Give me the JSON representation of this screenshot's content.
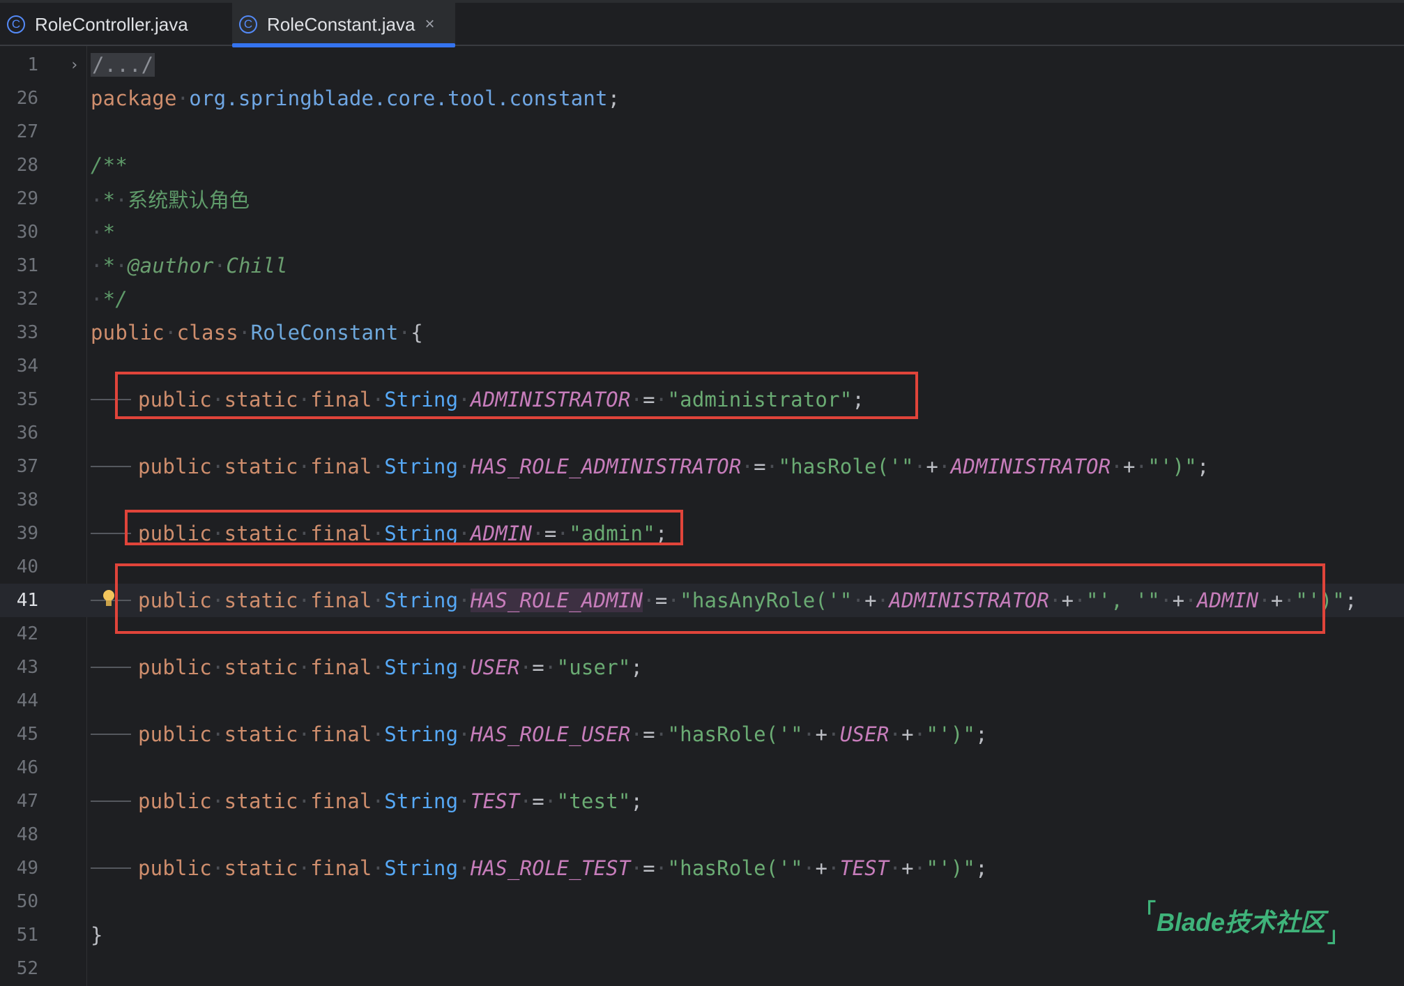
{
  "tabs": [
    {
      "label": "RoleController.java",
      "icon": "class-icon",
      "active": false
    },
    {
      "label": "RoleConstant.java",
      "icon": "class-icon",
      "active": true,
      "close": "×"
    }
  ],
  "editor": {
    "current_line": "41",
    "lines": [
      {
        "num": "1",
        "folded": "/.../"
      },
      {
        "num": "26",
        "kw": "package",
        "pkg": "org.springblade.core.tool.constant",
        "end": ";"
      },
      {
        "num": "27"
      },
      {
        "num": "28",
        "comment": "/**"
      },
      {
        "num": "29",
        "comment_star": "*",
        "comment_text": "系统默认角色"
      },
      {
        "num": "30",
        "comment_star": "*"
      },
      {
        "num": "31",
        "comment_star": "*",
        "tag": "@author",
        "tag_value": "Chill"
      },
      {
        "num": "32",
        "comment_end": "*/"
      },
      {
        "num": "33",
        "kw1": "public",
        "kw2": "class",
        "cls": "RoleConstant",
        "brace": "{"
      },
      {
        "num": "34"
      },
      {
        "num": "35",
        "mods": "public static final",
        "type": "String",
        "name": "ADMINISTRATOR",
        "eq": "=",
        "value": "\"administrator\"",
        "end": ";"
      },
      {
        "num": "36"
      },
      {
        "num": "37",
        "mods": "public static final",
        "type": "String",
        "name": "HAS_ROLE_ADMINISTRATOR",
        "eq": "=",
        "s1": "\"hasRole('\"",
        "op1": "+",
        "ref1": "ADMINISTRATOR",
        "op2": "+",
        "s2": "\"')\"",
        "end": ";"
      },
      {
        "num": "38"
      },
      {
        "num": "39",
        "mods": "public static final",
        "type": "String",
        "name": "ADMIN",
        "eq": "=",
        "value": "\"admin\"",
        "end": ";"
      },
      {
        "num": "40"
      },
      {
        "num": "41",
        "mods": "public static final",
        "type": "String",
        "name": "HAS_ROLE_ADMIN",
        "eq": "=",
        "s1": "\"hasAnyRole('\"",
        "op1": "+",
        "ref1": "ADMINISTRATOR",
        "op2": "+",
        "s2": "\"', '\"",
        "op3": "+",
        "ref2": "ADMIN",
        "op4": "+",
        "s3": "\"')\"",
        "end": ";"
      },
      {
        "num": "42"
      },
      {
        "num": "43",
        "mods": "public static final",
        "type": "String",
        "name": "USER",
        "eq": "=",
        "value": "\"user\"",
        "end": ";"
      },
      {
        "num": "44"
      },
      {
        "num": "45",
        "mods": "public static final",
        "type": "String",
        "name": "HAS_ROLE_USER",
        "eq": "=",
        "s1": "\"hasRole('\"",
        "op1": "+",
        "ref1": "USER",
        "op2": "+",
        "s2": "\"')\"",
        "end": ";"
      },
      {
        "num": "46"
      },
      {
        "num": "47",
        "mods": "public static final",
        "type": "String",
        "name": "TEST",
        "eq": "=",
        "value": "\"test\"",
        "end": ";"
      },
      {
        "num": "48"
      },
      {
        "num": "49",
        "mods": "public static final",
        "type": "String",
        "name": "HAS_ROLE_TEST",
        "eq": "=",
        "s1": "\"hasRole('\"",
        "op1": "+",
        "ref1": "TEST",
        "op2": "+",
        "s2": "\"')\"",
        "end": ";"
      },
      {
        "num": "50"
      },
      {
        "num": "51",
        "brace": "}"
      },
      {
        "num": "52"
      }
    ]
  },
  "watermark": {
    "text": "Blade技术社区",
    "open": "「",
    "close": "」"
  },
  "colors": {
    "accent": "#3574f0",
    "annotation_box": "#e0443a",
    "background": "#1e1f22"
  }
}
